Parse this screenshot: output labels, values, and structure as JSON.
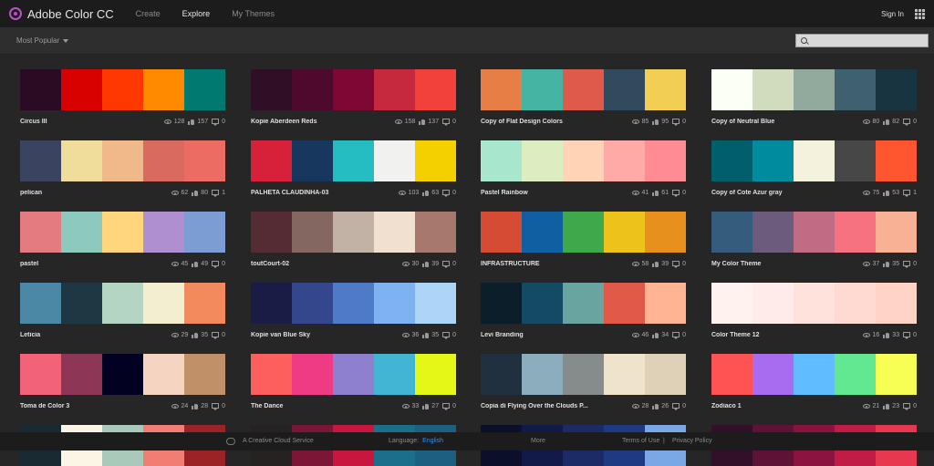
{
  "header": {
    "app_title": "Adobe Color CC",
    "logo_icon": "adobe-color-wheel-icon",
    "nav": [
      {
        "label": "Create",
        "active": false
      },
      {
        "label": "Explore",
        "active": true
      },
      {
        "label": "My Themes",
        "active": false
      }
    ],
    "sign_in": "Sign In",
    "apps_icon": "app-grid-icon",
    "accent": "#c04fd0"
  },
  "toolbar": {
    "sort_label": "Most Popular",
    "search_placeholder": ""
  },
  "themes": [
    {
      "name": "Circus III",
      "views": "128",
      "likes": "157",
      "comments": "0",
      "colors": [
        "#2b0a23",
        "#d90000",
        "#ff3700",
        "#ff8a00",
        "#007a70"
      ]
    },
    {
      "name": "Kopie Aberdeen Reds",
      "views": "158",
      "likes": "137",
      "comments": "0",
      "colors": [
        "#2f0e26",
        "#4e0a2c",
        "#7e0733",
        "#c6283e",
        "#f2413a"
      ]
    },
    {
      "name": "Copy of Flat Design Colors",
      "views": "85",
      "likes": "95",
      "comments": "0",
      "colors": [
        "#e67e45",
        "#46b4a2",
        "#e05a4b",
        "#324a5e",
        "#f2cf53"
      ]
    },
    {
      "name": "Copy of Neutral Blue",
      "views": "80",
      "likes": "82",
      "comments": "0",
      "colors": [
        "#fcfff5",
        "#d1dbbd",
        "#91aa9d",
        "#3e606f",
        "#193441"
      ]
    },
    {
      "name": "pelican",
      "views": "62",
      "likes": "80",
      "comments": "1",
      "colors": [
        "#3a4360",
        "#f1dd9b",
        "#f0b989",
        "#d86a5f",
        "#ec6c63"
      ]
    },
    {
      "name": "PALHETA CLAUDINHA-03",
      "views": "103",
      "likes": "63",
      "comments": "0",
      "colors": [
        "#d7203a",
        "#17375f",
        "#26bdc2",
        "#f1f1ef",
        "#f4d000"
      ]
    },
    {
      "name": "Pastel Rainbow",
      "views": "41",
      "likes": "61",
      "comments": "0",
      "colors": [
        "#a8e6ce",
        "#dcedc2",
        "#ffd3b5",
        "#ffaaa6",
        "#ff8c94"
      ]
    },
    {
      "name": "Copy of Cote Azur gray",
      "views": "75",
      "likes": "53",
      "comments": "1",
      "colors": [
        "#005f6b",
        "#008c9e",
        "#f4f1dc",
        "#474747",
        "#ff5630"
      ]
    },
    {
      "name": "pastel",
      "views": "45",
      "likes": "49",
      "comments": "0",
      "colors": [
        "#e47b80",
        "#8dc9bd",
        "#ffd57e",
        "#b08fd0",
        "#7b9dd3"
      ]
    },
    {
      "name": "toutCourt-02",
      "views": "30",
      "likes": "39",
      "comments": "0",
      "colors": [
        "#552c33",
        "#846760",
        "#c1b2a5",
        "#f1dfcf",
        "#a6786e"
      ]
    },
    {
      "name": "INFRASTRUCTURE",
      "views": "58",
      "likes": "39",
      "comments": "0",
      "colors": [
        "#d54b34",
        "#105fa3",
        "#3ea84a",
        "#edc21a",
        "#e8901e"
      ]
    },
    {
      "name": "My Color Theme",
      "views": "37",
      "likes": "35",
      "comments": "0",
      "colors": [
        "#355c7d",
        "#6c5b7b",
        "#c06c84",
        "#f67280",
        "#f8b195"
      ]
    },
    {
      "name": "Leticia",
      "views": "29",
      "likes": "35",
      "comments": "0",
      "colors": [
        "#4a88a6",
        "#1f3743",
        "#b4d5c4",
        "#f4eed1",
        "#f38a5e"
      ]
    },
    {
      "name": "Kopie van Blue Sky",
      "views": "36",
      "likes": "35",
      "comments": "0",
      "colors": [
        "#1a1c46",
        "#35478c",
        "#4e7ac7",
        "#7fb2f0",
        "#add5f7"
      ]
    },
    {
      "name": "Levi Branding",
      "views": "46",
      "likes": "34",
      "comments": "0",
      "colors": [
        "#0c1e29",
        "#144a63",
        "#6aa4a0",
        "#e15a49",
        "#ffb493"
      ]
    },
    {
      "name": "Color Theme 12",
      "views": "16",
      "likes": "33",
      "comments": "0",
      "colors": [
        "#fff2ef",
        "#ffebe9",
        "#ffe2dc",
        "#ffdad2",
        "#ffd3c5"
      ]
    },
    {
      "name": "Toma de Color 3",
      "views": "24",
      "likes": "28",
      "comments": "0",
      "colors": [
        "#f2637a",
        "#8d3656",
        "#020121",
        "#f6d4c2",
        "#c09069"
      ]
    },
    {
      "name": "The Dance",
      "views": "33",
      "likes": "27",
      "comments": "0",
      "colors": [
        "#fd5e5e",
        "#ee3b84",
        "#8e7fcf",
        "#41b5d3",
        "#e4f717"
      ]
    },
    {
      "name": "Copia di Flying Over the Clouds P...",
      "views": "28",
      "likes": "26",
      "comments": "0",
      "colors": [
        "#21303f",
        "#8cadbe",
        "#868c8c",
        "#efe3cc",
        "#dfd0b8"
      ]
    },
    {
      "name": "Zodiaco 1",
      "views": "21",
      "likes": "23",
      "comments": "0",
      "colors": [
        "#ff5252",
        "#a76cf0",
        "#61bdff",
        "#62e891",
        "#f7ff55"
      ]
    },
    {
      "name": "",
      "views": "",
      "likes": "",
      "comments": "",
      "colors": [
        "#1a2a33",
        "#fbf5e6",
        "#a9c9bb",
        "#f17e73",
        "#9c2325"
      ]
    },
    {
      "name": "",
      "views": "",
      "likes": "",
      "comments": "",
      "colors": [
        "#262222",
        "#7c1636",
        "#c8163f",
        "#1b6f8a",
        "#1d5f80"
      ]
    },
    {
      "name": "",
      "views": "",
      "likes": "",
      "comments": "",
      "colors": [
        "#0b0f2a",
        "#121a4a",
        "#1c2b66",
        "#1d3a82",
        "#7aa8e6"
      ]
    },
    {
      "name": "",
      "views": "",
      "likes": "",
      "comments": "",
      "colors": [
        "#33102a",
        "#5e1236",
        "#8a1340",
        "#c01c46",
        "#e8384f"
      ]
    }
  ],
  "footer": {
    "cc_icon": "creative-cloud-icon",
    "service": "A Creative Cloud Service",
    "language_label": "Language:",
    "language_value": "English",
    "more": "More",
    "terms": "Terms of Use",
    "separator": "|",
    "privacy": "Privacy Policy"
  }
}
